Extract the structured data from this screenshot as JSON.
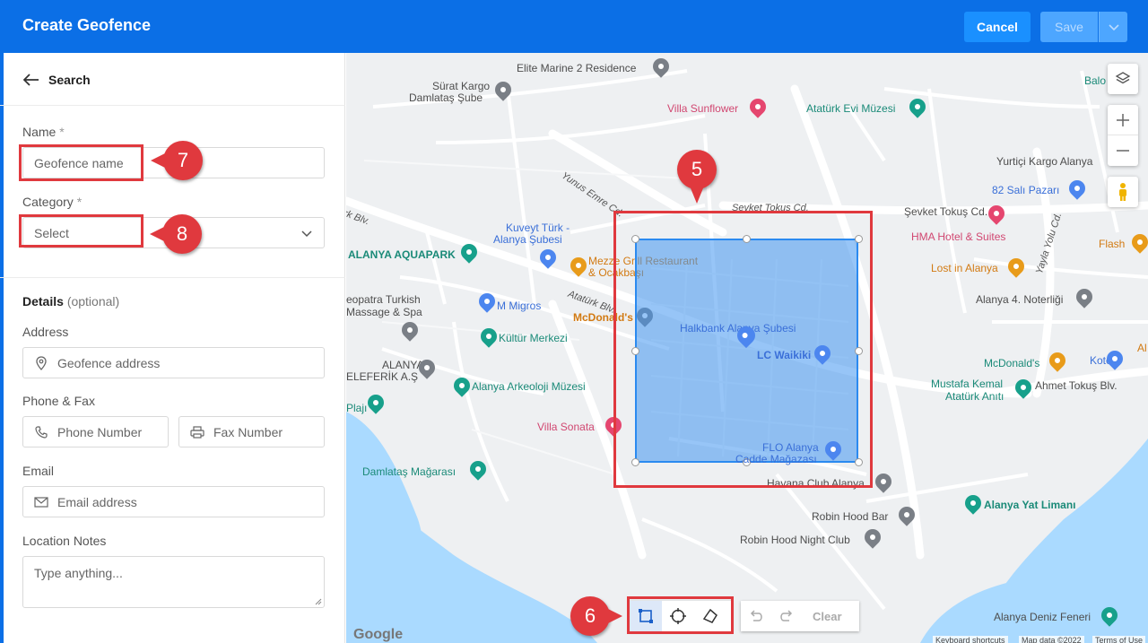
{
  "header": {
    "title": "Create Geofence",
    "cancel_label": "Cancel",
    "save_label": "Save"
  },
  "sidebar": {
    "back_label": "Search",
    "name": {
      "label": "Name",
      "required": "*",
      "placeholder": "Geofence name"
    },
    "category": {
      "label": "Category",
      "required": "*",
      "placeholder": "Select"
    },
    "details": {
      "title": "Details",
      "optional": "(optional)"
    },
    "address": {
      "label": "Address",
      "placeholder": "Geofence address"
    },
    "phone_fax": {
      "label": "Phone & Fax",
      "phone_placeholder": "Phone Number",
      "fax_placeholder": "Fax Number"
    },
    "email": {
      "label": "Email",
      "placeholder": "Email address"
    },
    "notes": {
      "label": "Location Notes",
      "placeholder": "Type anything..."
    }
  },
  "callouts": {
    "c5": "5",
    "c6": "6",
    "c7": "7",
    "c8": "8"
  },
  "map": {
    "pois": [
      {
        "text": "Elite Marine 2 Residence",
        "color": "grey"
      },
      {
        "text": "Sürat Kargo",
        "color": "grey"
      },
      {
        "text": "Damlataş Şube",
        "color": "grey"
      },
      {
        "text": "Villa Sunflower",
        "color": "pink"
      },
      {
        "text": "Atatürk Evi Müzesi",
        "color": "teal"
      },
      {
        "text": "Balo",
        "color": "teal"
      },
      {
        "text": "Yurtiçi Kargo Alanya",
        "color": "grey"
      },
      {
        "text": "82 Salı Pazarı",
        "color": "blue"
      },
      {
        "text": "Şevket Tokuş Cd.",
        "color": "grey"
      },
      {
        "text": "HMA Hotel & Suites",
        "color": "pink"
      },
      {
        "text": "Flash",
        "color": "orange"
      },
      {
        "text": "Lost in Alanya",
        "color": "orange"
      },
      {
        "text": "Alanya 4. Noterliği",
        "color": "grey"
      },
      {
        "text": "Kuveyt Türk -",
        "color": "blue"
      },
      {
        "text": "Alanya Şubesi",
        "color": "blue"
      },
      {
        "text": "ALANYA AQUAPARK",
        "color": "teal"
      },
      {
        "text": "Mezze Grill Restaurant",
        "color": "orange"
      },
      {
        "text": "& Ocakbaşı",
        "color": "orange"
      },
      {
        "text": "M Migros",
        "color": "blue"
      },
      {
        "text": "eopatra Turkish",
        "color": "grey"
      },
      {
        "text": "Massage & Spa",
        "color": "grey"
      },
      {
        "text": "McDonald's",
        "color": "orange"
      },
      {
        "text": "Halkbank Alanya Şubesi",
        "color": "blue"
      },
      {
        "text": "Kültür Merkezi",
        "color": "teal"
      },
      {
        "text": "LC Waikiki",
        "color": "blue"
      },
      {
        "text": "McDonald's",
        "color": "orange"
      },
      {
        "text": "Koton",
        "color": "blue"
      },
      {
        "text": "ALANYA",
        "color": "grey"
      },
      {
        "text": "ELEFERİK A.Ş",
        "color": "grey"
      },
      {
        "text": "Alanya Arkeoloji Müzesi",
        "color": "teal"
      },
      {
        "text": "Mustafa Kemal",
        "color": "teal"
      },
      {
        "text": "Atatürk Anıtı",
        "color": "teal"
      },
      {
        "text": "Ahmet Tokuş Blv.",
        "color": "grey"
      },
      {
        "text": "Plajı",
        "color": "teal"
      },
      {
        "text": "Villa Sonata",
        "color": "pink"
      },
      {
        "text": "FLO Alanya",
        "color": "blue"
      },
      {
        "text": "Cadde Mağazası",
        "color": "blue"
      },
      {
        "text": "Damlataş Mağarası",
        "color": "teal"
      },
      {
        "text": "Havana Club Alanya",
        "color": "grey"
      },
      {
        "text": "Alanya Yat Limanı",
        "color": "teal"
      },
      {
        "text": "Robin Hood Bar",
        "color": "grey"
      },
      {
        "text": "Robin Hood Night Club",
        "color": "grey"
      },
      {
        "text": "Alanya Deniz Feneri",
        "color": "grey"
      },
      {
        "text": "Al",
        "color": "orange"
      }
    ],
    "streets": {
      "yunus_emre": "Yunus Emre Cd.",
      "sevket": "Şevket Tokuş Cd.",
      "ataturk": "Atatürk Blv.",
      "rk_blv": "rk Blv.",
      "yayla": "Yayla Yolu Cd."
    },
    "clear_label": "Clear",
    "google": "Google",
    "attribution": {
      "shortcuts": "Keyboard shortcuts",
      "mapdata": "Map data ©2022",
      "terms": "Terms of Use"
    }
  }
}
